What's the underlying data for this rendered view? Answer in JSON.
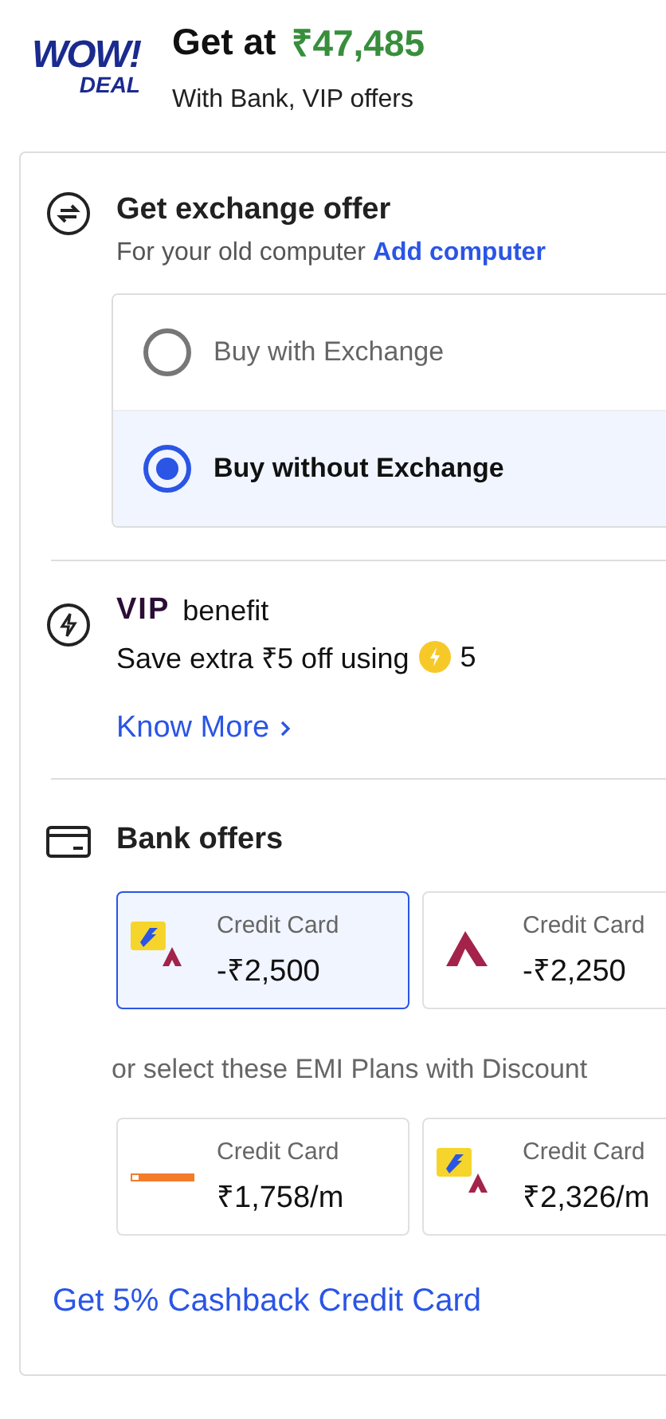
{
  "deal": {
    "logo_top": "WOW!",
    "logo_bottom": "DEAL",
    "label": "Get at",
    "price": "₹47,485",
    "subtitle": "With Bank, VIP offers"
  },
  "exchange": {
    "title": "Get exchange offer",
    "subtitle": "For your old computer",
    "link": "Add computer",
    "options": [
      {
        "label": "Buy with Exchange",
        "selected": false
      },
      {
        "label": "Buy without Exchange",
        "selected": true
      }
    ]
  },
  "vip": {
    "brand": "VIP",
    "title": "benefit",
    "text": "Save extra ₹5 off using",
    "coins": "5",
    "link": "Know More"
  },
  "bank_offers": {
    "title": "Bank offers",
    "offers": [
      {
        "kind": "combo",
        "type": "Credit Card",
        "amount": "-₹2,500",
        "selected": true
      },
      {
        "kind": "axis",
        "type": "Credit Card",
        "amount": "-₹2,250",
        "selected": false
      }
    ],
    "emi_label": "or select these EMI Plans with Discount",
    "emi_plans": [
      {
        "kind": "bob",
        "type": "Credit Card",
        "amount": "₹1,758/m",
        "selected": false
      },
      {
        "kind": "combo",
        "type": "Credit Card",
        "amount": "₹2,326/m",
        "selected": false
      }
    ],
    "footer_link": "Get 5% Cashback Credit Card"
  }
}
